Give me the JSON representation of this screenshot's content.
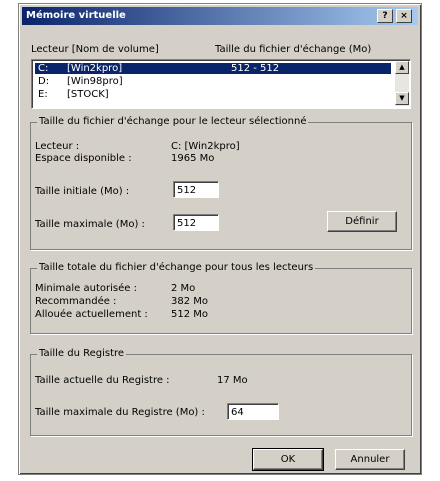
{
  "window": {
    "title": "Mémoire virtuelle",
    "help_btn": "?",
    "close_btn": "×"
  },
  "drive_list": {
    "header_drive": "Lecteur [Nom de volume]",
    "header_size": "Taille du fichier d'échange (Mo)",
    "rows": [
      {
        "letter": "C:",
        "name": "[Win2kpro]",
        "size": "512 - 512",
        "selected": true
      },
      {
        "letter": "D:",
        "name": "[Win98pro]",
        "size": "",
        "selected": false
      },
      {
        "letter": "E:",
        "name": "[STOCK]",
        "size": "",
        "selected": false
      }
    ],
    "scroll_up": "▲",
    "scroll_down": "▼"
  },
  "selected_drive_group": {
    "title": "Taille du fichier d'échange pour le lecteur sélectionné",
    "drive_label": "Lecteur :",
    "drive_value": "C: [Win2kpro]",
    "space_label": "Espace disponible :",
    "space_value": "1965 Mo",
    "initial_label": "Taille initiale (Mo) :",
    "initial_value": "512",
    "max_label": "Taille maximale (Mo) :",
    "max_value": "512",
    "define_button": "Définir"
  },
  "total_group": {
    "title": "Taille totale du fichier d'échange pour tous les lecteurs",
    "min_label": "Minimale autorisée :",
    "min_value": "2 Mo",
    "rec_label": "Recommandée :",
    "rec_value": "382 Mo",
    "alloc_label": "Allouée actuellement :",
    "alloc_value": "512 Mo"
  },
  "registry_group": {
    "title": "Taille du Registre",
    "current_label": "Taille actuelle du Registre :",
    "current_value": "17 Mo",
    "max_label": "Taille maximale du Registre (Mo) :",
    "max_value": "64"
  },
  "buttons": {
    "ok": "OK",
    "cancel": "Annuler"
  }
}
